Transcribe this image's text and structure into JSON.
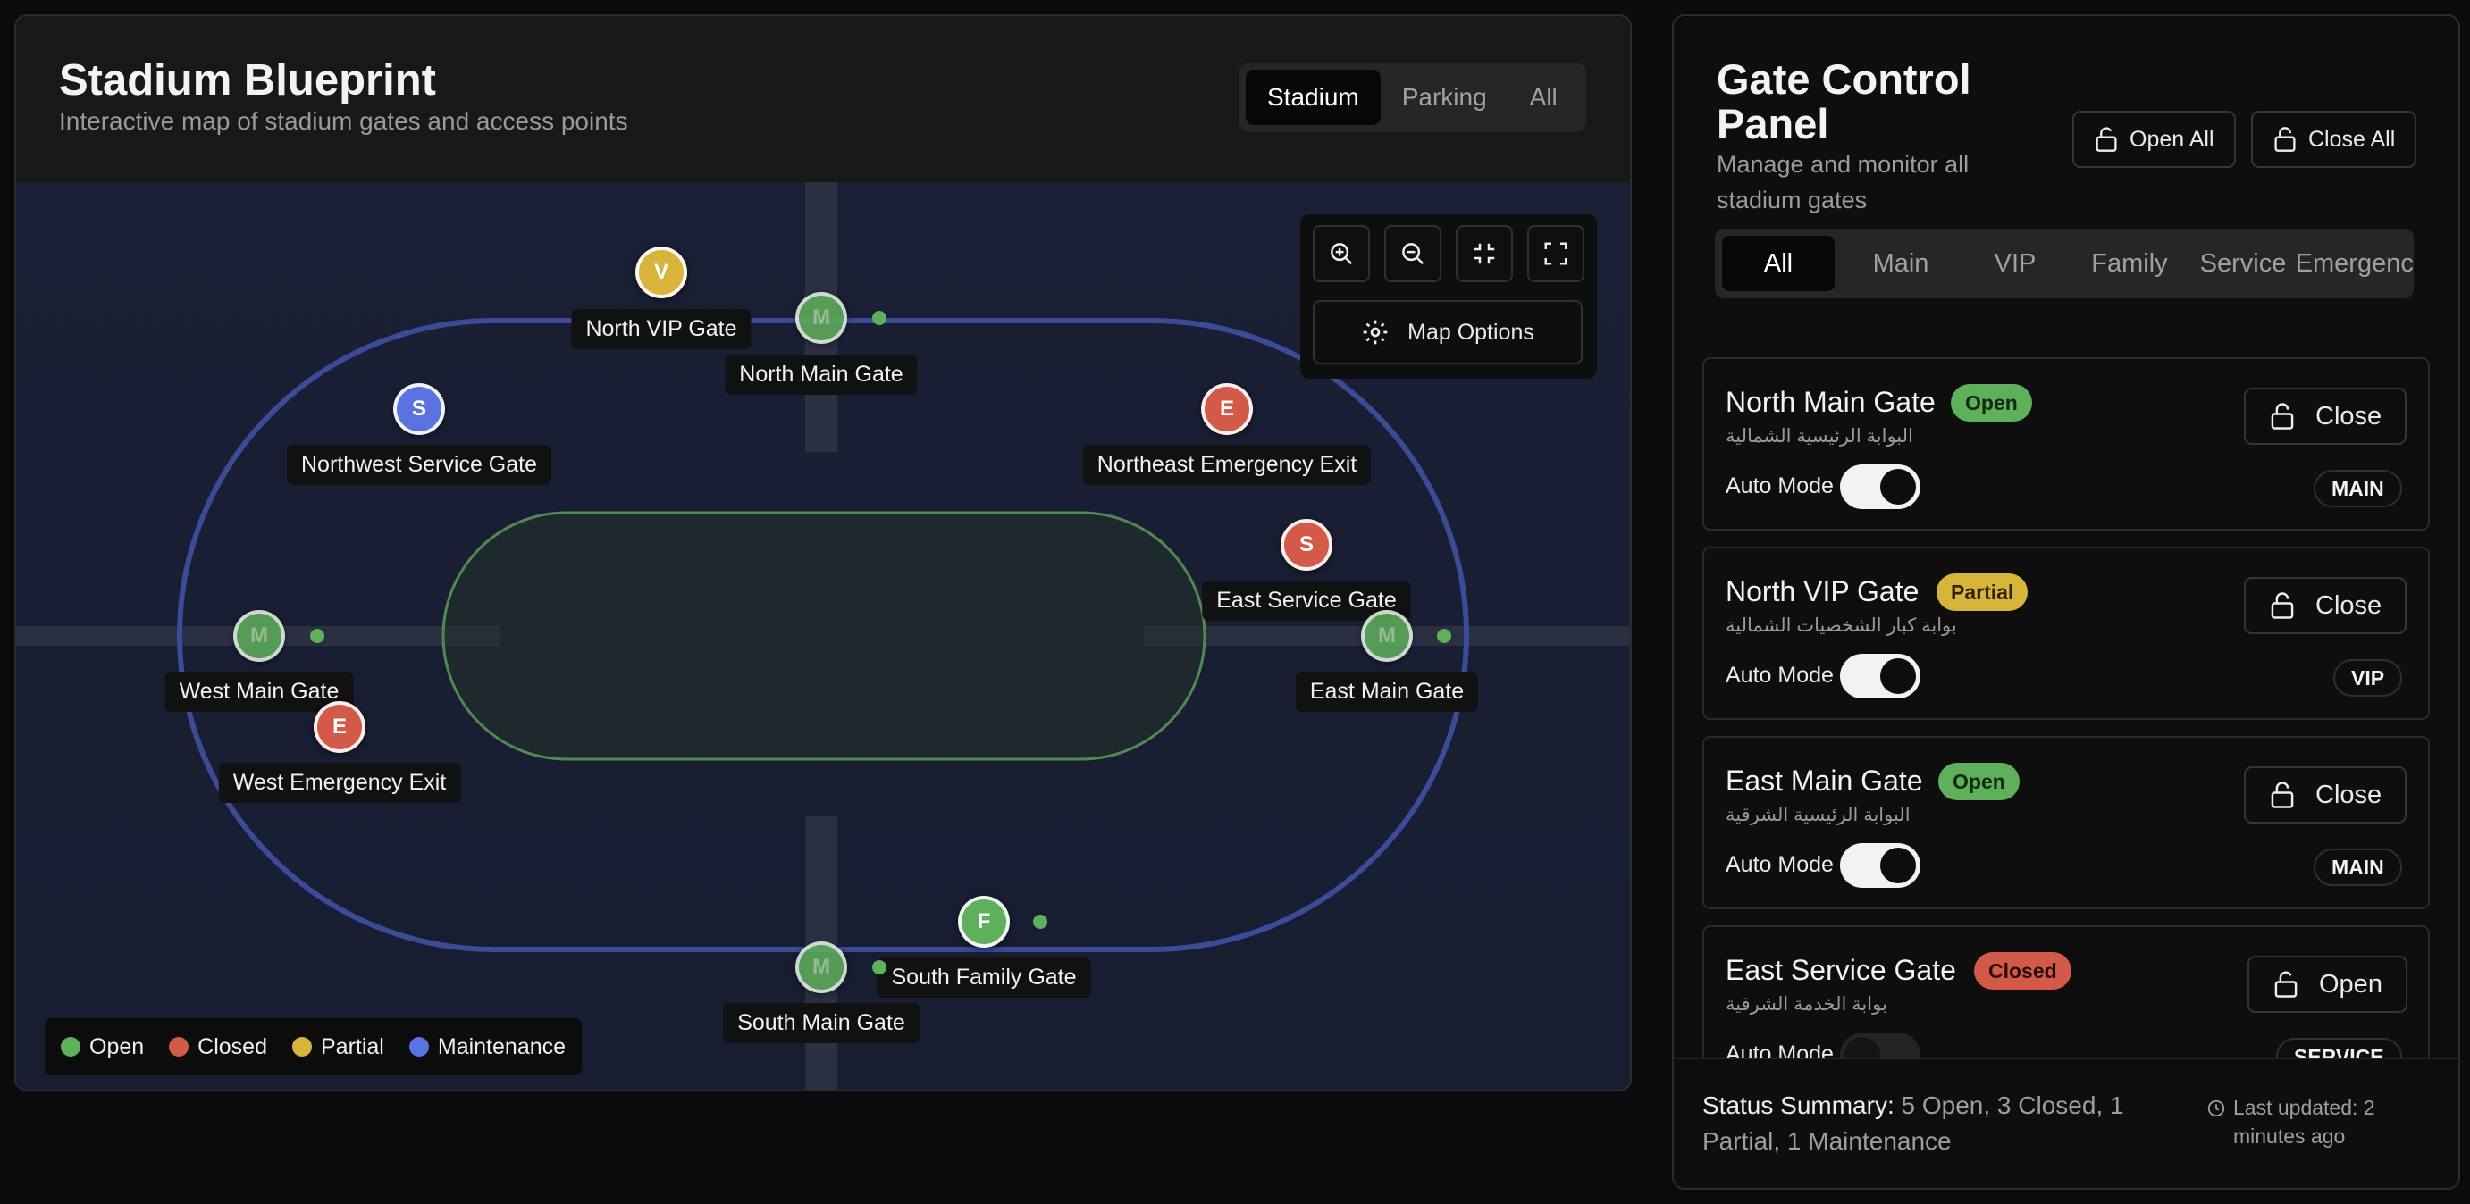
{
  "map": {
    "title": "Stadium Blueprint",
    "subtitle": "Interactive map of stadium gates and access points",
    "view_tabs": [
      "Stadium",
      "Parking",
      "All"
    ],
    "active_view": "Stadium",
    "controls": {
      "map_options_label": "Map Options"
    },
    "gates": [
      {
        "name": "North VIP Gate",
        "letter": "V",
        "status": "partial"
      },
      {
        "name": "North Main Gate",
        "letter": "M",
        "status": "open"
      },
      {
        "name": "Northwest Service Gate",
        "letter": "S",
        "status": "maintenance"
      },
      {
        "name": "Northeast Emergency Exit",
        "letter": "E",
        "status": "closed"
      },
      {
        "name": "East Service Gate",
        "letter": "S",
        "status": "closed"
      },
      {
        "name": "West Main Gate",
        "letter": "M",
        "status": "open"
      },
      {
        "name": "East Main Gate",
        "letter": "M",
        "status": "open"
      },
      {
        "name": "West Emergency Exit",
        "letter": "E",
        "status": "closed"
      },
      {
        "name": "South Family Gate",
        "letter": "F",
        "status": "open"
      },
      {
        "name": "South Main Gate",
        "letter": "M",
        "status": "open"
      }
    ],
    "legend": [
      {
        "label": "Open",
        "color": "#5fb05a"
      },
      {
        "label": "Closed",
        "color": "#d35a48"
      },
      {
        "label": "Partial",
        "color": "#d8b43a"
      },
      {
        "label": "Maintenance",
        "color": "#5b73e0"
      }
    ]
  },
  "panel": {
    "title": "Gate Control Panel",
    "subtitle": "Manage and monitor all stadium gates",
    "open_all_label": "Open All",
    "close_all_label": "Close All",
    "filters": [
      "All",
      "Main",
      "VIP",
      "Family",
      "Service",
      "Emergency"
    ],
    "active_filter": "All",
    "cards": [
      {
        "name": "North Main Gate",
        "arabic": "البوابة الرئيسية الشمالية",
        "status_label": "Open",
        "status": "open",
        "auto_mode_label": "Auto Mode",
        "auto_mode": true,
        "action": "Close",
        "type": "MAIN"
      },
      {
        "name": "North VIP Gate",
        "arabic": "بوابة كبار الشخصيات الشمالية",
        "status_label": "Partial",
        "status": "partial",
        "auto_mode_label": "Auto Mode",
        "auto_mode": true,
        "action": "Close",
        "type": "VIP"
      },
      {
        "name": "East Main Gate",
        "arabic": "البوابة الرئيسية الشرقية",
        "status_label": "Open",
        "status": "open",
        "auto_mode_label": "Auto Mode",
        "auto_mode": true,
        "action": "Close",
        "type": "MAIN"
      },
      {
        "name": "East Service Gate",
        "arabic": "بوابة الخدمة الشرقية",
        "status_label": "Closed",
        "status": "closed",
        "auto_mode_label": "Auto Mode",
        "auto_mode": false,
        "action": "Open",
        "type": "SERVICE"
      }
    ],
    "summary": {
      "lead": "Status Summary:",
      "text": "5 Open, 3 Closed, 1 Partial, 1 Maintenance",
      "updated": "Last updated: 2 minutes ago"
    }
  },
  "colors": {
    "open": "#5fb05a",
    "closed": "#d35a48",
    "partial": "#d8b43a",
    "maintenance": "#5b73e0"
  }
}
